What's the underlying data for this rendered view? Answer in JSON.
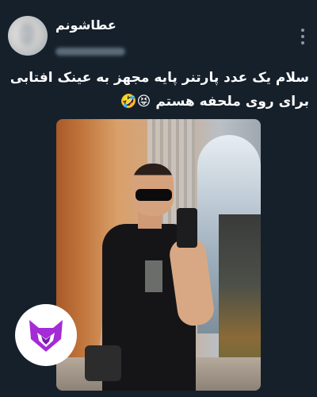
{
  "post": {
    "display_name": "عطاشونم",
    "text_line1": "سلام یک عدد پارتنر پایه مجهز به عینک افتابی",
    "text_line2": "برای روی ملحفه هستم 😝🤣"
  },
  "icons": {
    "more": "more-vertical-icon",
    "logo": "purple-fox-logo"
  },
  "colors": {
    "background": "#15202b",
    "text": "#ffffff",
    "muted": "#8b98a5",
    "logo_purple": "#a42bd6"
  }
}
